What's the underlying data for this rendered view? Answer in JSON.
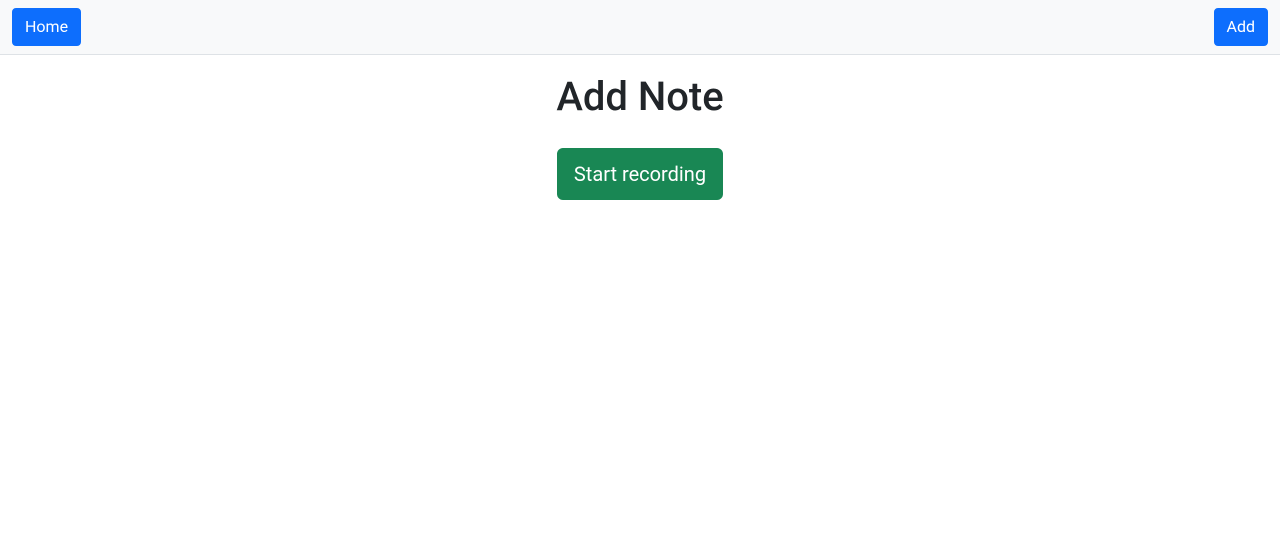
{
  "navbar": {
    "home_label": "Home",
    "add_label": "Add"
  },
  "main": {
    "title": "Add Note",
    "record_button_label": "Start recording"
  }
}
